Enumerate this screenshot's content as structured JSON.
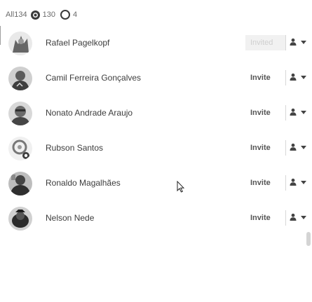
{
  "filters": {
    "all_label": "All",
    "all_count": "134",
    "online_count": "130",
    "offline_count": "4"
  },
  "users": [
    {
      "name": "Rafael Pagelkopf",
      "invite_label": "Invited",
      "invite_state": "invited",
      "avatar_color": "#7a7a7a"
    },
    {
      "name": "Camil Ferreira Gonçalves",
      "invite_label": "Invite",
      "invite_state": "invite",
      "avatar_color": "#4e4e4e"
    },
    {
      "name": "Nonato Andrade Araujo",
      "invite_label": "Invite",
      "invite_state": "invite",
      "avatar_color": "#5a5a5a"
    },
    {
      "name": "Rubson Santos",
      "invite_label": "Invite",
      "invite_state": "invite",
      "avatar_color": "#8a8a8a"
    },
    {
      "name": "Ronaldo Magalhães",
      "invite_label": "Invite",
      "invite_state": "invite",
      "avatar_color": "#3f3f3f"
    },
    {
      "name": "Nelson Nede",
      "invite_label": "Invite",
      "invite_state": "invite",
      "avatar_color": "#303030"
    }
  ],
  "colors": {
    "text": "#3c3c3c",
    "muted": "#6b6b6b",
    "invited_bg": "#f1f1f1",
    "invited_text": "#cfcfcf",
    "divider": "#d7d7d7"
  },
  "icons": {
    "online_filter": "filled-circle-icon",
    "offline_filter": "outline-circle-icon",
    "role": "people-icon",
    "dropdown": "caret-down-icon"
  }
}
